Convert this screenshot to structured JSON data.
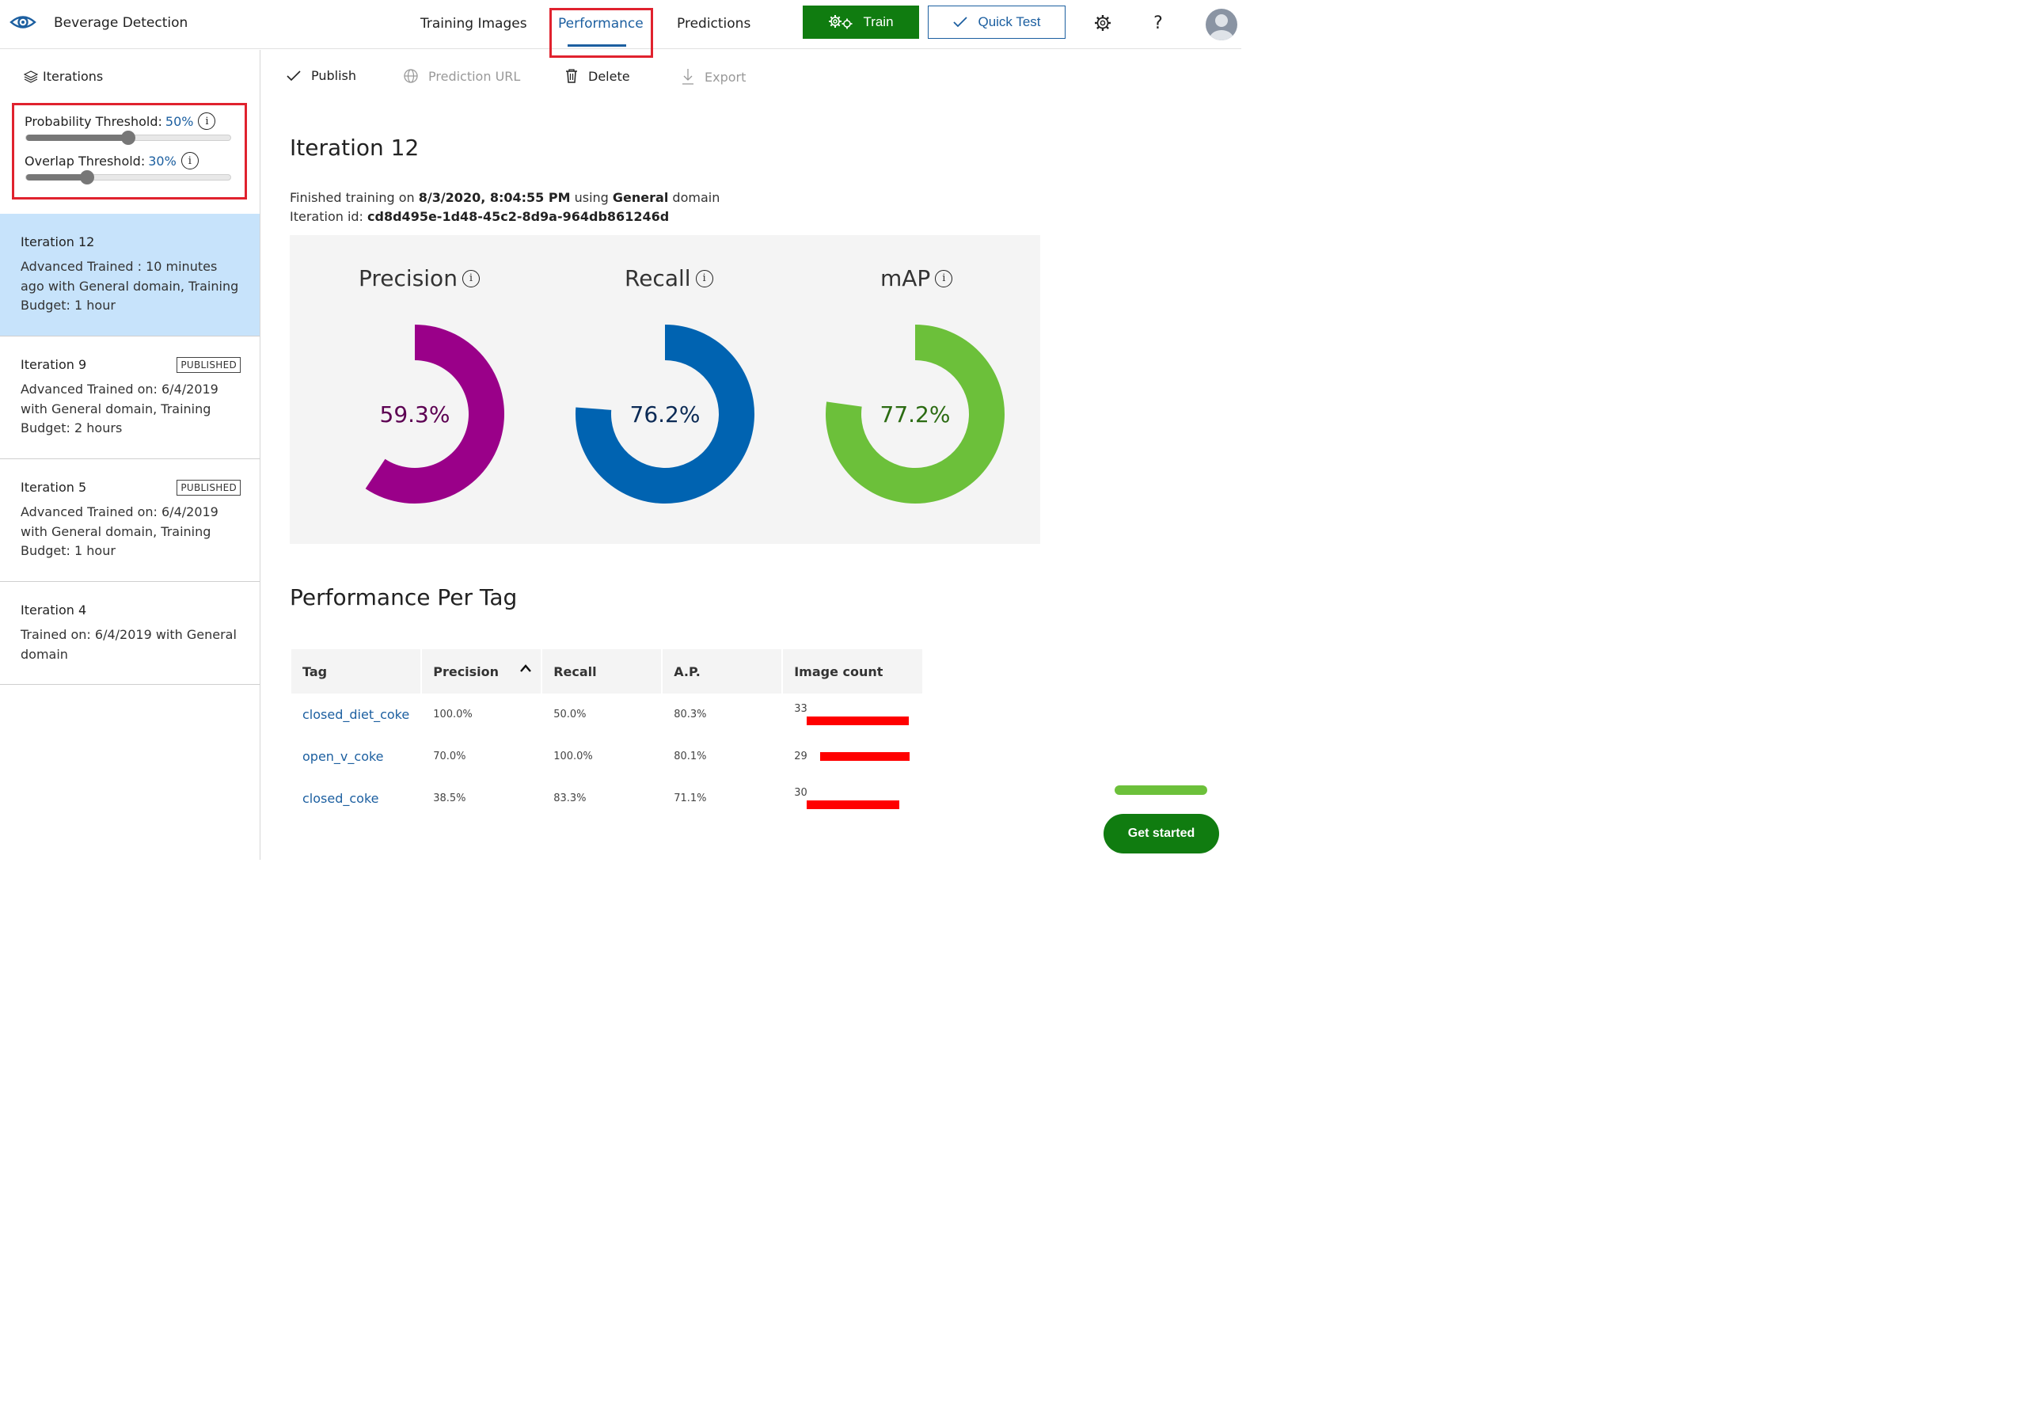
{
  "app": {
    "title": "Beverage Detection"
  },
  "nav": {
    "tabs": [
      {
        "label": "Training Images"
      },
      {
        "label": "Performance"
      },
      {
        "label": "Predictions"
      }
    ]
  },
  "header_buttons": {
    "train": "Train",
    "quick_test": "Quick Test"
  },
  "sidebar": {
    "header": "Iterations",
    "probability_threshold": {
      "label": "Probability Threshold:",
      "value": "50%",
      "level": 0.5
    },
    "overlap_threshold": {
      "label": "Overlap Threshold:",
      "value": "30%",
      "level": 0.3
    },
    "iterations": [
      {
        "title": "Iteration 12",
        "desc": "Advanced Trained : 10 minutes ago with General domain, Training Budget: 1 hour",
        "badge": ""
      },
      {
        "title": "Iteration 9",
        "desc": "Advanced Trained on: 6/4/2019 with General domain, Training Budget: 2 hours",
        "badge": "PUBLISHED"
      },
      {
        "title": "Iteration 5",
        "desc": "Advanced Trained on: 6/4/2019 with General domain, Training Budget: 1 hour",
        "badge": "PUBLISHED"
      },
      {
        "title": "Iteration 4",
        "desc": "Trained on: 6/4/2019 with General domain",
        "badge": ""
      }
    ]
  },
  "toolbar": {
    "publish": "Publish",
    "prediction_url": "Prediction URL",
    "delete": "Delete",
    "export": "Export"
  },
  "main": {
    "title": "Iteration 12",
    "finished_prefix": "Finished training on ",
    "finished_date": "8/3/2020, 8:04:55 PM",
    "finished_mid": " using ",
    "finished_domain": "General",
    "finished_suffix": " domain",
    "iteration_id_label": "Iteration id: ",
    "iteration_id": "cd8d495e-1d48-45c2-8d9a-964db861246d"
  },
  "metrics": [
    {
      "label": "Precision",
      "value_text": "59.3%",
      "value": 59.3,
      "color": "#9a0089",
      "text_color": "#5c0052"
    },
    {
      "label": "Recall",
      "value_text": "76.2%",
      "value": 76.2,
      "color": "#0063b1",
      "text_color": "#0b2a55"
    },
    {
      "label": "mAP",
      "value_text": "77.2%",
      "value": 77.2,
      "color": "#6cc03a",
      "text_color": "#2b6b12"
    }
  ],
  "per_tag": {
    "title": "Performance Per Tag",
    "columns": [
      "Tag",
      "Precision",
      "Recall",
      "A.P.",
      "Image count"
    ],
    "rows": [
      {
        "tag": "closed_diet_coke",
        "precision": "100.0%",
        "recall": "50.0%",
        "ap": "80.3%",
        "count": "33",
        "count_value": 33
      },
      {
        "tag": "open_v_coke",
        "precision": "70.0%",
        "recall": "100.0%",
        "ap": "80.1%",
        "count": "29",
        "count_value": 29
      },
      {
        "tag": "closed_coke",
        "precision": "38.5%",
        "recall": "83.3%",
        "ap": "71.1%",
        "count": "30",
        "count_value": 30
      }
    ]
  },
  "get_started": "Get started"
}
